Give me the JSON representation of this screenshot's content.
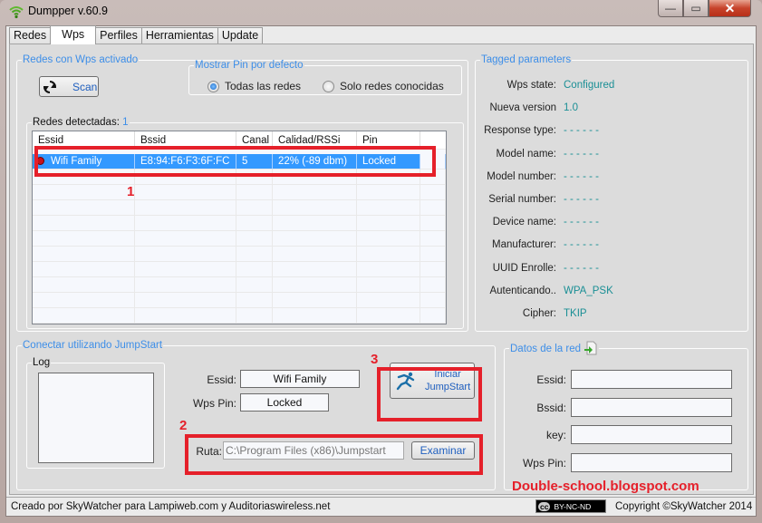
{
  "window": {
    "title": "Dumpper v.60.9",
    "controls": {
      "minimize": "—",
      "maximize": "▭",
      "close": "✕"
    }
  },
  "tabs": [
    {
      "label": "Redes",
      "active": false
    },
    {
      "label": "Wps",
      "active": true
    },
    {
      "label": "Perfiles",
      "active": false
    },
    {
      "label": "Herramientas",
      "active": false
    },
    {
      "label": "Update",
      "active": false
    }
  ],
  "wps_group": {
    "legend": "Redes con Wps activado",
    "scan_button": "Scan",
    "pin_group": {
      "legend": "Mostrar Pin por defecto",
      "options": [
        {
          "label": "Todas las redes",
          "selected": true
        },
        {
          "label": "Solo redes conocidas",
          "selected": false
        }
      ]
    },
    "detected": {
      "label": "Redes detectadas:",
      "count": "1"
    },
    "table": {
      "columns": [
        "Essid",
        "Bssid",
        "Canal",
        "Calidad/RSSi",
        "Pin"
      ],
      "rows": [
        {
          "essid": "Wifi Family",
          "bssid": "E8:94:F6:F3:6F:FC",
          "canal": "5",
          "calidad": "22% (-89 dbm)",
          "pin": "Locked",
          "selected": true,
          "status_icon": "locked-red-dot"
        }
      ]
    }
  },
  "tagged": {
    "legend": "Tagged parameters",
    "items": [
      {
        "label": "Wps state:",
        "value": "Configured"
      },
      {
        "label": "Nueva version",
        "value": "1.0"
      },
      {
        "label": "Response type:",
        "value": "- - - - - -"
      },
      {
        "label": "Model name:",
        "value": "- - - - - -"
      },
      {
        "label": "Model number:",
        "value": "- - - - - -"
      },
      {
        "label": "Serial number:",
        "value": "- - - - - -"
      },
      {
        "label": "Device name:",
        "value": "- - - - - -"
      },
      {
        "label": "Manufacturer:",
        "value": "- - - - - -"
      },
      {
        "label": "UUID Enrolle:",
        "value": "- - - - - -"
      },
      {
        "label": "Autenticando..",
        "value": "WPA_PSK"
      },
      {
        "label": "Cipher:",
        "value": "TKIP"
      }
    ]
  },
  "jumpstart": {
    "legend": "Conectar utilizando JumpStart",
    "log_legend": "Log",
    "essid_label": "Essid:",
    "essid_value": "Wifi Family",
    "pin_label": "Wps Pin:",
    "pin_value": "Locked",
    "start_button_line1": "Iniciar",
    "start_button_line2": "JumpStart",
    "ruta_label": "Ruta:",
    "ruta_value": "C:\\Program Files (x86)\\Jumpstart",
    "browse_button": "Examinar"
  },
  "network_data": {
    "legend": "Datos de la red",
    "fields": [
      {
        "label": "Essid:",
        "value": ""
      },
      {
        "label": "Bssid:",
        "value": ""
      },
      {
        "label": "key:",
        "value": ""
      },
      {
        "label": "Wps Pin:",
        "value": ""
      }
    ]
  },
  "annotations": {
    "n1": "1",
    "n2": "2",
    "n3": "3",
    "watermark": "Double-school.blogspot.com",
    "color": "#e5202a"
  },
  "status_bar": {
    "credits": "Creado por SkyWatcher para Lampiweb.com y Auditoriaswireless.net",
    "license_badge_cc": "cc",
    "license_badge_text": "BY-NC-ND",
    "copyright": "Copyright ©SkyWatcher 2014"
  }
}
